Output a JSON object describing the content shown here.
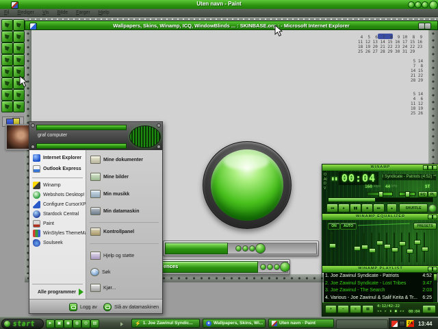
{
  "paint": {
    "title": "Uten navn - Paint",
    "menu": [
      "Fil",
      "Rediger",
      "Vis",
      "Bilde",
      "Farger",
      "Hjelp"
    ]
  },
  "ie": {
    "title": "Wallpapers, Skins, Winamp, ICQ, WindowBlinds ... : SKINBASE.org : - Microsoft Internet Explorer",
    "calendar": {
      "rows": [
        " 4  5  6  7  8  9 10",
        "11 12 13 14 15 16 17",
        "18 19 20 21 22 23 24",
        "25 26 27 28 29 30 31"
      ],
      "side": [
        " 8  9",
        "15 16",
        "22 23",
        "29"
      ],
      "frag_a": [
        " 5 14",
        " 7  8",
        "14 15",
        "21 22",
        "28 29"
      ],
      "frag_b": [
        " 5 14",
        " 4  6",
        "11 12",
        "18 19",
        "25 26"
      ]
    },
    "bar_text": "ences"
  },
  "startmenu": {
    "user": "graf computer",
    "left": [
      "Internet Explorer",
      "Outlook Express",
      "Winamp",
      "Webshots Desktop!",
      "Configure CursorXP",
      "Stardock Central",
      "Paint",
      "WinStyles ThemeManager",
      "Soulseek"
    ],
    "all_programs": "Alle programmer",
    "right": [
      "Mine dokumenter",
      "Mine bilder",
      "Min musikk",
      "Min datamaskin",
      "Kontrollpanel",
      "Hjelp og støtte",
      "Søk",
      "Kjør..."
    ],
    "logoff": "Logg av",
    "shutdown": "Slå av datamaskinen"
  },
  "winamp": {
    "main": {
      "title": "WINAMP",
      "clutter": "OAIDV",
      "time": "00:04",
      "track": "l Syndicate - Patriots (4:52) ***",
      "kbps": "160",
      "kbps_label": "kbps",
      "khz": "44",
      "khz_label": "kHz",
      "stereo": "ST",
      "eq": "EQ",
      "pl": "PL",
      "controls": [
        "◂◂",
        "▸",
        "▮▮",
        "■",
        "▸▸"
      ],
      "eject": "▴",
      "shuffle": "SHUFFLE"
    },
    "eq": {
      "title": "WINAMP EQUALIZER",
      "on": "ON",
      "auto": "AUTO",
      "presets": "PRESETS",
      "slider_positions_pct": [
        40,
        50,
        45,
        58,
        30,
        43,
        55,
        33,
        60,
        28,
        52
      ]
    },
    "playlist": {
      "title": "WINAMP PLAYLIST",
      "items": [
        {
          "num": "1.",
          "title": "Joe Zawinul Syndicate - Patriots",
          "time": "4:52"
        },
        {
          "num": "2.",
          "title": "Joe Zawinul Syndicate - Lost Tribes",
          "time": "3:47"
        },
        {
          "num": "3.",
          "title": "Joe Zawinul - The Search",
          "time": "2:03"
        },
        {
          "num": "4.",
          "title": "Various - Joe Zawinul & Salif Keita & Tr...",
          "time": "6:25"
        }
      ],
      "btns": [
        "+",
        "−",
        "≡",
        "▤",
        "▥"
      ],
      "counter": "4:12/42:22",
      "mini": "◂◂ ▸ ▮ ■ ▸▸",
      "clock": "00:04"
    }
  },
  "taskbar": {
    "start": "start",
    "ql": [
      "►",
      "▣",
      "◉",
      "◍",
      "◎",
      "▤"
    ],
    "tasks": [
      "1. Joe Zawinul Syndic...",
      "Wallpapers, Skins, Wi...",
      "Uten navn - Paint"
    ],
    "task_icons": [
      "⚡",
      "e"
    ],
    "tray_za": "ZA",
    "clock": "13:44"
  },
  "colors": {
    "accent_green": "#3fae20",
    "lcd_green": "#a8ff70",
    "title_green": "#2d930f"
  }
}
